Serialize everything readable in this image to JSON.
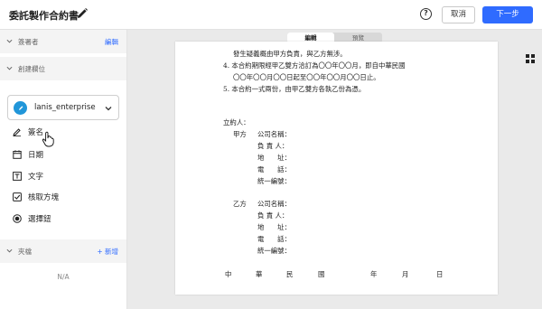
{
  "header": {
    "title": "委託製作合約書",
    "help": "?",
    "cancel_label": "取消",
    "next_label": "下一步"
  },
  "sidebar": {
    "signers": {
      "label": "簽署者",
      "action": "編輯"
    },
    "create_fields": {
      "label": "創建欄位"
    },
    "account": {
      "name": "lanis_enterprise"
    },
    "fields": [
      {
        "label": "簽名",
        "icon": "signature-pen-icon"
      },
      {
        "label": "日期",
        "icon": "calendar-icon"
      },
      {
        "label": "文字",
        "icon": "text-icon"
      },
      {
        "label": "核取方塊",
        "icon": "checkbox-icon"
      },
      {
        "label": "選擇鈕",
        "icon": "radio-icon"
      }
    ],
    "attachments": {
      "label": "夾檔",
      "action": "+ 新增",
      "empty": "N/A"
    }
  },
  "view_toggle": {
    "edit": "編輯",
    "preview": "預覽"
  },
  "document": {
    "lines": [
      "發生疑義概由甲方負責，與乙方無涉。",
      "4. 本合約期限經甲乙雙方洽訂為〇〇年〇〇月，即自中華民國",
      "〇〇年〇〇月〇〇日起至〇〇年〇〇月〇〇日止。",
      "5. 本合約一式兩份，由甲乙雙方各執乙份為憑。"
    ],
    "signatory_label": "立約人：",
    "party_a_label": "甲方",
    "party_b_label": "乙方",
    "party_fields": [
      "公司名稱：",
      "負 責 人：",
      "地　　址：",
      "電　　話：",
      "統一編號："
    ],
    "date_line": [
      "中",
      "華",
      "民",
      "國",
      "年",
      "月",
      "日"
    ]
  },
  "colors": {
    "accent": "#2f6bff",
    "avatar": "#2196d9"
  }
}
